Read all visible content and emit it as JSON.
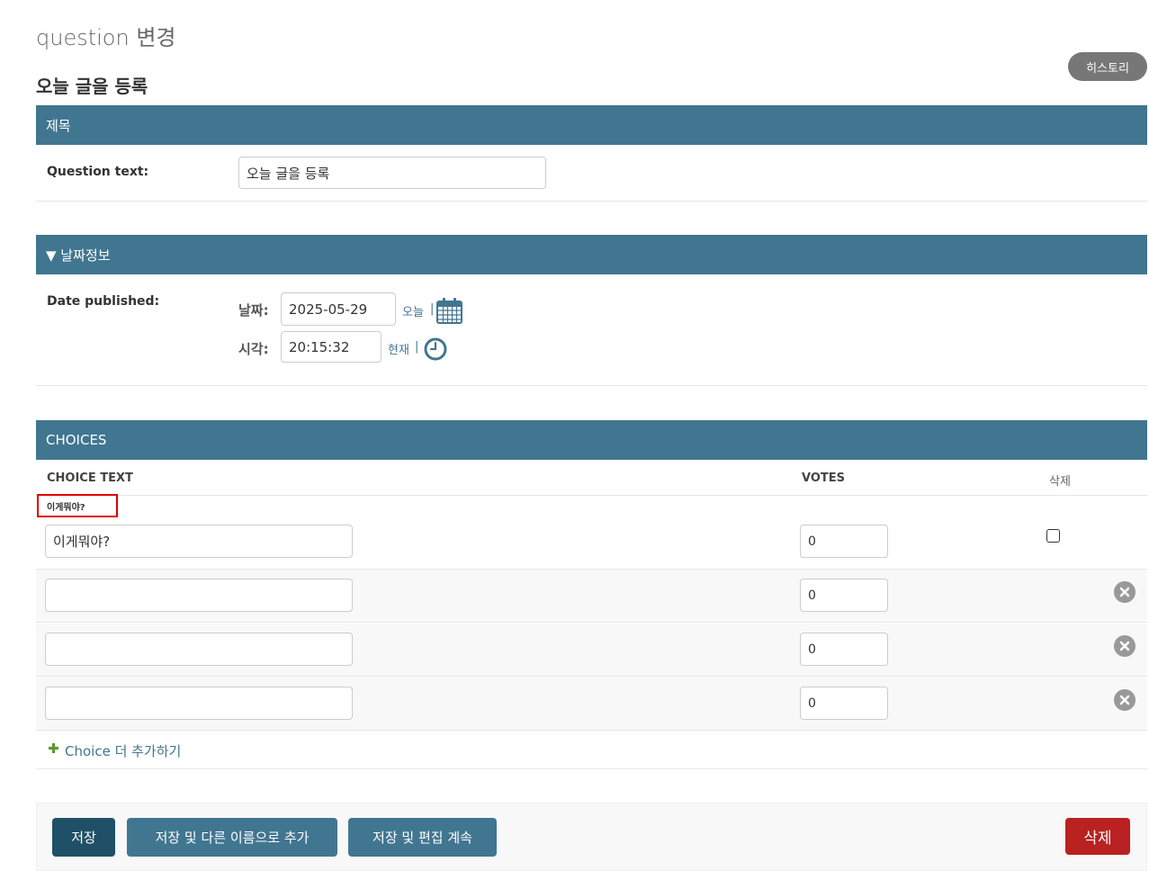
{
  "header": {
    "page_title": "question 변경",
    "object_title": "오늘 글을 등록",
    "history_label": "히스토리"
  },
  "section_title": {
    "title": "제목",
    "question_text_label": "Question text:",
    "question_text_value": "오늘 글을 등록"
  },
  "section_date": {
    "title": "▼ 날짜정보",
    "date_published_label": "Date published:",
    "date_label": "날짜:",
    "date_value": "2025-05-29",
    "today_link": "오늘",
    "time_label": "시각:",
    "time_value": "20:15:32",
    "now_link": "현재",
    "separator": "|"
  },
  "choices": {
    "title": "CHOICES",
    "col_choice_text": "CHOICE TEXT",
    "col_votes": "VOTES",
    "col_delete": "삭제",
    "original_label": "이게뭐야?",
    "rows": [
      {
        "text": "이게뭐야?",
        "votes": "0"
      },
      {
        "text": "",
        "votes": "0"
      },
      {
        "text": "",
        "votes": "0"
      },
      {
        "text": "",
        "votes": "0"
      }
    ],
    "add_link": "Choice 더 추가하기"
  },
  "submit": {
    "save": "저장",
    "save_add_another": "저장 및 다른 이름으로 추가",
    "save_continue": "저장 및 편집 계속",
    "delete": "삭제"
  },
  "colors": {
    "header_bg": "#417690",
    "save_bg": "#205067",
    "button_bg": "#417690",
    "delete_bg": "#ba2121",
    "add_icon": "#5b9a2f"
  },
  "icons": [
    "calendar-icon",
    "clock-icon",
    "delete-row-icon",
    "add-icon"
  ]
}
